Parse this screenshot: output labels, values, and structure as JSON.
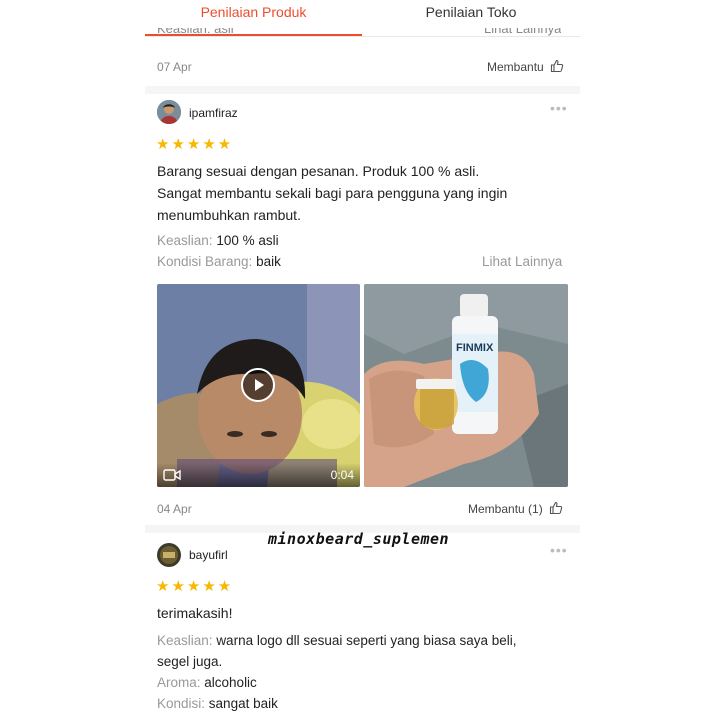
{
  "tabs": [
    {
      "label": "Penilaian Produk",
      "active": true
    },
    {
      "label": "Penilaian Toko",
      "active": false
    }
  ],
  "accent_color": "#ee4d2d",
  "star_color": "#f6b800",
  "top_clipped": {
    "left_text": "Keaslian: asli",
    "right_text": "Lihat Lainnya",
    "date": "07 Apr",
    "helpful_label": "Membantu"
  },
  "reviews": [
    {
      "username": "ipamfiraz",
      "rating": 5,
      "stars": "★★★★★",
      "text_lines": [
        "Barang sesuai dengan pesanan. Produk 100 % asli.",
        "Sangat membantu sekali bagi para pengguna yang ingin",
        "menumbuhkan rambut."
      ],
      "attributes": [
        {
          "label": "Keaslian:",
          "value": "100 % asli"
        },
        {
          "label": "Kondisi Barang:",
          "value": "baik"
        }
      ],
      "see_more": "Lihat Lainnya",
      "video_duration": "0:04",
      "product_label": "FINMIX",
      "date": "04 Apr",
      "helpful_label": "Membantu (1)"
    },
    {
      "username": "bayufirl",
      "rating": 5,
      "stars": "★★★★★",
      "text": "terimakasih!",
      "attributes": [
        {
          "label": "Keaslian:",
          "value": "warna logo dll sesuai seperti yang biasa saya beli,"
        },
        {
          "label": "",
          "value": "segel juga."
        },
        {
          "label": "Aroma:",
          "value": "alcoholic"
        },
        {
          "label": "Kondisi:",
          "value": "sangat baik"
        }
      ]
    }
  ],
  "watermark": "minoxbeard_suplemen",
  "icons": [
    "thumbs-up-icon",
    "more-dots-icon",
    "play-icon",
    "video-camera-icon",
    "star-icon"
  ]
}
